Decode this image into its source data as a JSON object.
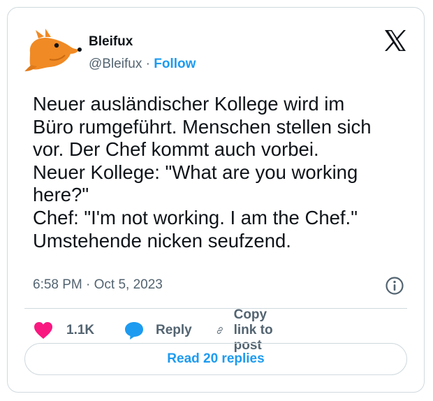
{
  "tweet": {
    "author_name": "Bleifux",
    "author_handle": "@Bleifux",
    "separator": " · ",
    "follow_label": "Follow",
    "text": "Neuer ausländischer Kollege wird im\nBüro rumgeführt. Menschen stellen sich\nvor. Der Chef kommt auch vorbei.\nNeuer Kollege: \"What are you working\nhere?\"\nChef: \"I'm not working. I am the Chef.\"\nUmstehende nicken seufzend.",
    "timestamp": "6:58 PM · Oct 5, 2023"
  },
  "actions": {
    "likes": "1.1K",
    "reply_label": "Reply",
    "copy_link_label": "Copy link to post"
  },
  "read_replies_label": "Read 20 replies",
  "colors": {
    "accent": "#1d9bf0",
    "like": "#f91880",
    "secondary_text": "#536471",
    "border": "#cfd9de",
    "avatar": "#f08a24"
  },
  "icons": [
    "fox-avatar-icon",
    "x-logo-icon",
    "info-icon",
    "heart-icon",
    "speech-bubble-icon",
    "link-icon"
  ]
}
